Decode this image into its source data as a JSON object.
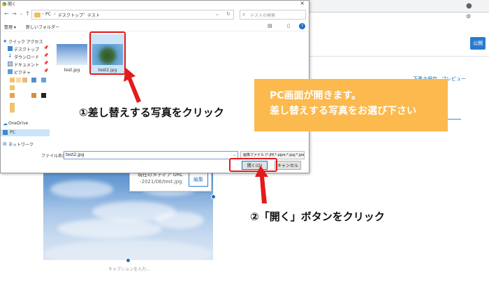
{
  "dialog": {
    "title": "開く",
    "close_glyph": "×",
    "breadcrumbs": [
      "PC",
      "デスクトップ",
      "テスト"
    ],
    "search_placeholder": "テストの検索",
    "toolbar": {
      "organize": "整理 ▾",
      "new_folder": "新しいフォルダー",
      "help": "?"
    },
    "nav": {
      "quick_access": "クイック アクセス",
      "items": [
        {
          "label": "デスクトップ"
        },
        {
          "label": "ダウンロード"
        },
        {
          "label": "ドキュメント"
        },
        {
          "label": "ピクチャ"
        }
      ],
      "onedrive": "OneDrive",
      "pc": "PC",
      "network": "ネットワーク"
    },
    "files": [
      {
        "name": "test.jpg"
      },
      {
        "name": "test2.jpg"
      }
    ],
    "filename_label": "ファイル名(N):",
    "filename_value": "test2.jpg",
    "filetype_value": "画像ファイル (*.jfif;*.pjpe;*.jpg;*.jpe",
    "open_button": "開く(O)",
    "cancel_button": "キャンセル"
  },
  "editor": {
    "save_draft": "下書き保存",
    "preview": "プレビュー",
    "publish": "公開",
    "media_label": "現在のメディア URL",
    "media_url": "-2021/06/test.jpg",
    "media_edit": "編集",
    "caption_placeholder": "キャプションを入力..."
  },
  "annotations": {
    "step1": "①差し替えする写真をクリック",
    "step2": "②「開く」ボタンをクリック",
    "callout_line1": "PC画面が開きます。",
    "callout_line2": "差し替えする写真をお選び下さい",
    "accent_color": "#e31b1b",
    "callout_color": "#fbb94e"
  }
}
